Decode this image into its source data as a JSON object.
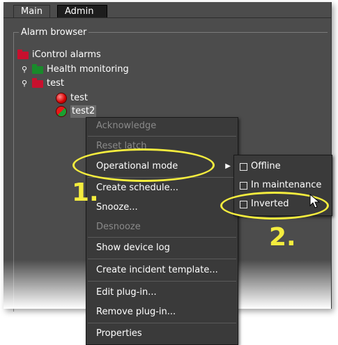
{
  "tabs": [
    {
      "label": "Main"
    },
    {
      "label": "Admin"
    }
  ],
  "panel": {
    "title": "Alarm browser"
  },
  "tree": {
    "root": {
      "label": "iControl alarms",
      "icon": "folder-red-icon"
    },
    "items": [
      {
        "label": "Health monitoring",
        "icon": "folder-green-icon"
      },
      {
        "label": "test",
        "icon": "folder-red-icon"
      },
      {
        "label": "test",
        "icon": "alarm-red-icon"
      },
      {
        "label": "test2",
        "icon": "alarm-red-green-icon"
      }
    ]
  },
  "context_menu": {
    "items": [
      {
        "label": "Acknowledge",
        "enabled": false
      },
      {
        "label": "Reset latch",
        "enabled": false
      },
      {
        "label": "Operational mode",
        "enabled": true,
        "submenu": true
      },
      {
        "label": "Create schedule...",
        "enabled": true
      },
      {
        "label": "Snooze...",
        "enabled": true
      },
      {
        "label": "Desnooze",
        "enabled": false
      },
      {
        "label": "Show device log",
        "enabled": true
      },
      {
        "label": "Create incident template...",
        "enabled": true
      },
      {
        "label": "Edit plug-in...",
        "enabled": true
      },
      {
        "label": "Remove plug-in...",
        "enabled": true
      },
      {
        "label": "Properties",
        "enabled": true
      }
    ]
  },
  "submenu": {
    "items": [
      {
        "label": "Offline",
        "checked": false
      },
      {
        "label": "In maintenance",
        "checked": false
      },
      {
        "label": "Inverted",
        "checked": false
      }
    ]
  },
  "callouts": {
    "step1": "1.",
    "step2": "2."
  },
  "colors": {
    "panel_bg": "#4c4c4c",
    "menu_bg": "#3a3a3a",
    "highlight": "#f4ec3e",
    "folder_red": "#c8102e",
    "folder_green": "#198a2b"
  }
}
